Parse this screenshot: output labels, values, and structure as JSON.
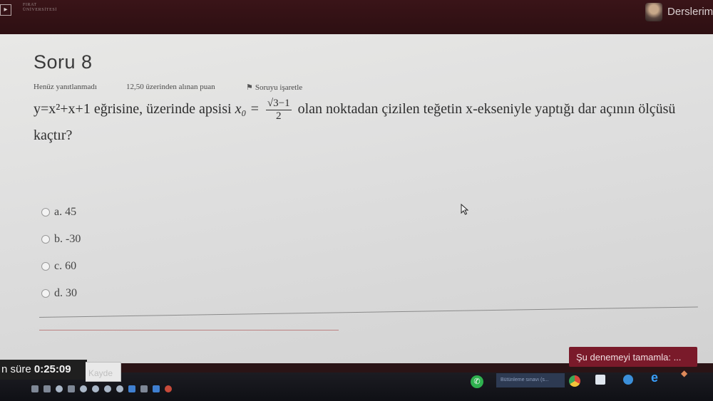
{
  "header": {
    "logo_text": "FIRAT\nÜNİVERSİTESİ",
    "nav_link": "Derslerim"
  },
  "question": {
    "title": "Soru 8",
    "status": "Henüz yanıtlanmadı",
    "points": "12,50 üzerinden alınan puan",
    "flag_label": "Soruyu işaretle",
    "text_before": "y=x²+x+1 eğrisine, üzerinde apsisi ",
    "var_x0": "x₀ =",
    "frac_num": "√3−1",
    "frac_den": "2",
    "text_after": " olan noktadan çizilen teğetin x-ekseniyle yaptığı dar açının ölçüsü kaçtır?",
    "options": [
      {
        "label": "a. 45"
      },
      {
        "label": "b. -30"
      },
      {
        "label": "c. 60"
      },
      {
        "label": "d. 30"
      }
    ]
  },
  "footer": {
    "timer_prefix": "n süre ",
    "timer_value": "0:25:09",
    "save_label": "Kayde",
    "finish_label": "Şu denemeyi tamamla: ..."
  },
  "taskbar": {
    "task_label": "Bütünleme sınavı (s..."
  },
  "colors": {
    "topbar": "#2d0f12",
    "finish_button": "#7a1a2a"
  }
}
